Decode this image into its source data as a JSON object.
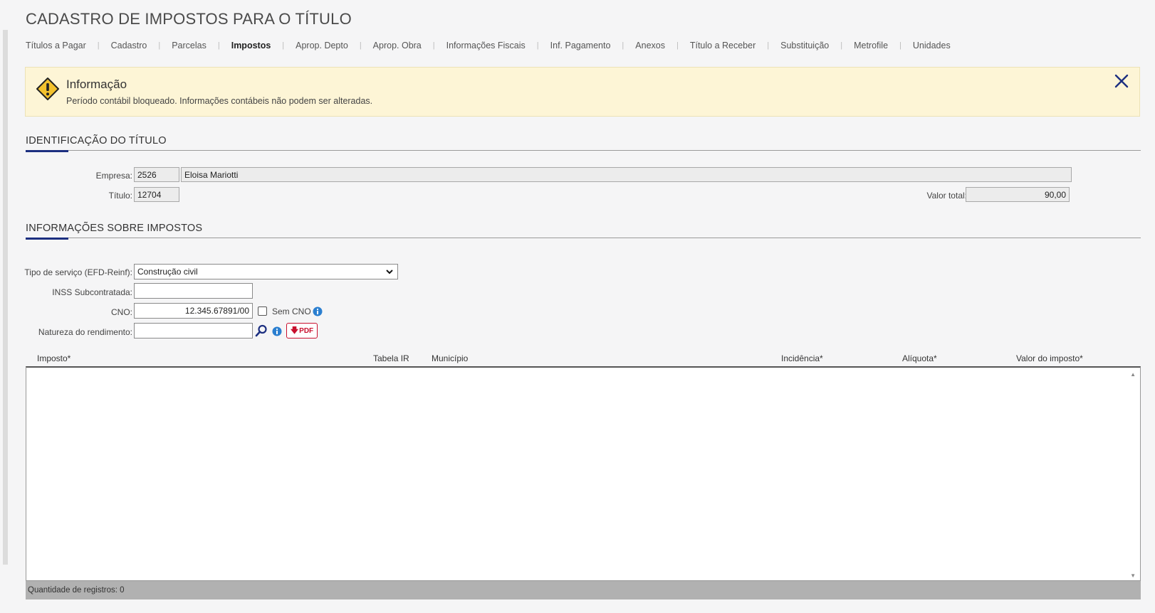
{
  "page": {
    "title": "CADASTRO DE IMPOSTOS PARA O TÍTULO"
  },
  "tabs": [
    {
      "label": "Títulos a Pagar",
      "active": false
    },
    {
      "label": "Cadastro",
      "active": false
    },
    {
      "label": "Parcelas",
      "active": false
    },
    {
      "label": "Impostos",
      "active": true
    },
    {
      "label": "Aprop. Depto",
      "active": false
    },
    {
      "label": "Aprop. Obra",
      "active": false
    },
    {
      "label": "Informações Fiscais",
      "active": false
    },
    {
      "label": "Inf. Pagamento",
      "active": false
    },
    {
      "label": "Anexos",
      "active": false
    },
    {
      "label": "Título a Receber",
      "active": false
    },
    {
      "label": "Substituição",
      "active": false
    },
    {
      "label": "Metrofile",
      "active": false
    },
    {
      "label": "Unidades",
      "active": false
    }
  ],
  "tab_separator": "|",
  "alert": {
    "title": "Informação",
    "message": "Período contábil bloqueado. Informações contábeis não podem ser alteradas.",
    "icon": "warning-icon",
    "close_icon": "close-icon",
    "color": "#fdf5d6"
  },
  "identificacao": {
    "section_title": "IDENTIFICAÇÃO DO TÍTULO",
    "empresa_label": "Empresa:",
    "empresa_code": "2526",
    "empresa_name": "Eloisa Mariotti",
    "titulo_label": "Título:",
    "titulo_value": "12704",
    "valor_total_label": "Valor total:",
    "valor_total_value": "90,00"
  },
  "impostos": {
    "section_title": "INFORMAÇÕES SOBRE IMPOSTOS",
    "tipo_servico_label": "Tipo de serviço (EFD-Reinf):",
    "tipo_servico_value": "Construção civil",
    "inss_label": "INSS Subcontratada:",
    "inss_value": "",
    "cno_label": "CNO:",
    "cno_value": "12.345.67891/00",
    "sem_cno_label": "Sem CNO",
    "sem_cno_checked": false,
    "natureza_label": "Natureza do rendimento:",
    "natureza_value": "",
    "pdf_label": "PDF"
  },
  "grid": {
    "columns": [
      "Imposto*",
      "Tabela IR",
      "Município",
      "Incidência*",
      "Alíquota*",
      "Valor do imposto*"
    ],
    "rows": [],
    "footer": "Quantidade de registros: 0"
  },
  "colors": {
    "accent": "#1c2f80",
    "pdf": "#c8102e",
    "info": "#2b7fd0",
    "warning": "#f2c12e"
  }
}
